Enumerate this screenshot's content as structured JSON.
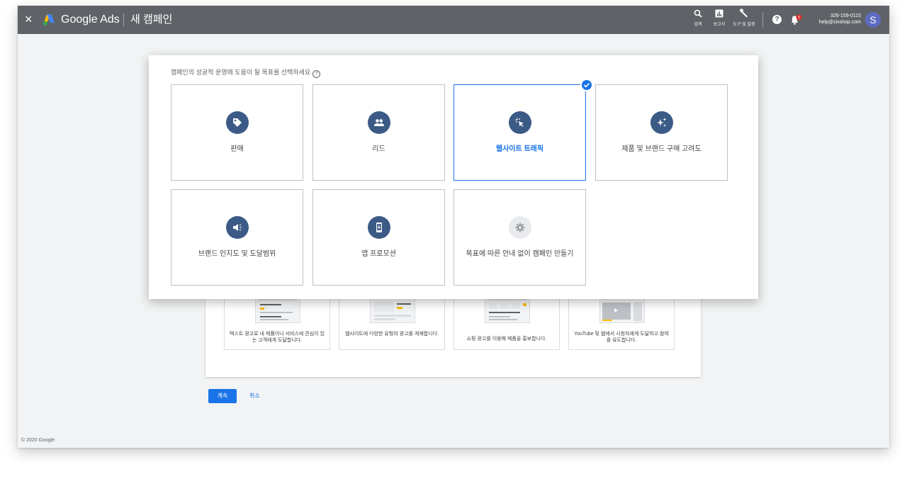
{
  "header": {
    "close": "×",
    "brand": "Google Ads",
    "title": "새 캠페인",
    "tools": [
      {
        "label": "검색",
        "icon": "search-icon"
      },
      {
        "label": "보고서",
        "icon": "report-icon"
      },
      {
        "label": "도구 및 설정",
        "icon": "wrench-icon"
      }
    ],
    "help": "?",
    "account_id": "326-159-0115",
    "account_email": "help@sixshop.com",
    "avatar_letter": "S"
  },
  "modal": {
    "question": "캠페인의 성공적 운영에 도움이 될 목표를 선택하세요",
    "goals": [
      {
        "label": "판매",
        "icon": "tag-icon",
        "selected": false
      },
      {
        "label": "리드",
        "icon": "people-icon",
        "selected": false
      },
      {
        "label": "웹사이트 트래픽",
        "icon": "cursor-click-icon",
        "selected": true
      },
      {
        "label": "제품 및 브랜드 구매 고려도",
        "icon": "sparkle-icon",
        "selected": false
      },
      {
        "label": "브랜드 인지도 및 도달범위",
        "icon": "speaker-icon",
        "selected": false
      },
      {
        "label": "앱 프로모션",
        "icon": "phone-download-icon",
        "selected": false
      },
      {
        "label": "목표에 따른 안내 없이 캠페인 만들기",
        "icon": "gear-icon",
        "selected": false
      }
    ]
  },
  "campaign_types": [
    {
      "desc": "텍스트 광고로 내 제품이나 서비스에 관심이 있는 고객에게 도달합니다."
    },
    {
      "desc": "웹사이트에 다양한 유형의 광고를 게재합니다."
    },
    {
      "desc": "쇼핑 광고를 이용해 제품을 홍보합니다."
    },
    {
      "desc": "YouTube 및 웹에서 시청자에게 도달하고 참여를 유도합니다."
    }
  ],
  "actions": {
    "continue": "계속",
    "cancel": "취소"
  },
  "footer": "© 2020 Google",
  "colors": {
    "topbar": "#5f6368",
    "accent": "#1a73e8",
    "icon_bg": "#3c5a86"
  }
}
